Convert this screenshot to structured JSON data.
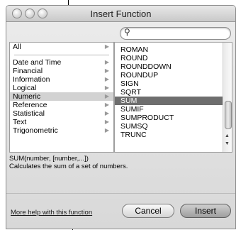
{
  "window": {
    "title": "Insert Function"
  },
  "search": {
    "value": "",
    "placeholder": ""
  },
  "categories": [
    "All",
    "Date and Time",
    "Financial",
    "Information",
    "Logical",
    "Numeric",
    "Reference",
    "Statistical",
    "Text",
    "Trigonometric"
  ],
  "selected_category": "Numeric",
  "functions": [
    "ROMAN",
    "ROUND",
    "ROUNDDOWN",
    "ROUNDUP",
    "SIGN",
    "SQRT",
    "SUM",
    "SUMIF",
    "SUMPRODUCT",
    "SUMSQ",
    "TRUNC"
  ],
  "selected_function": "SUM",
  "description": {
    "signature": "SUM(number, [number,...])",
    "text": "Calculates the sum of a set of numbers."
  },
  "footer": {
    "help_link": "More help with this function",
    "cancel_label": "Cancel",
    "insert_label": "Insert"
  }
}
